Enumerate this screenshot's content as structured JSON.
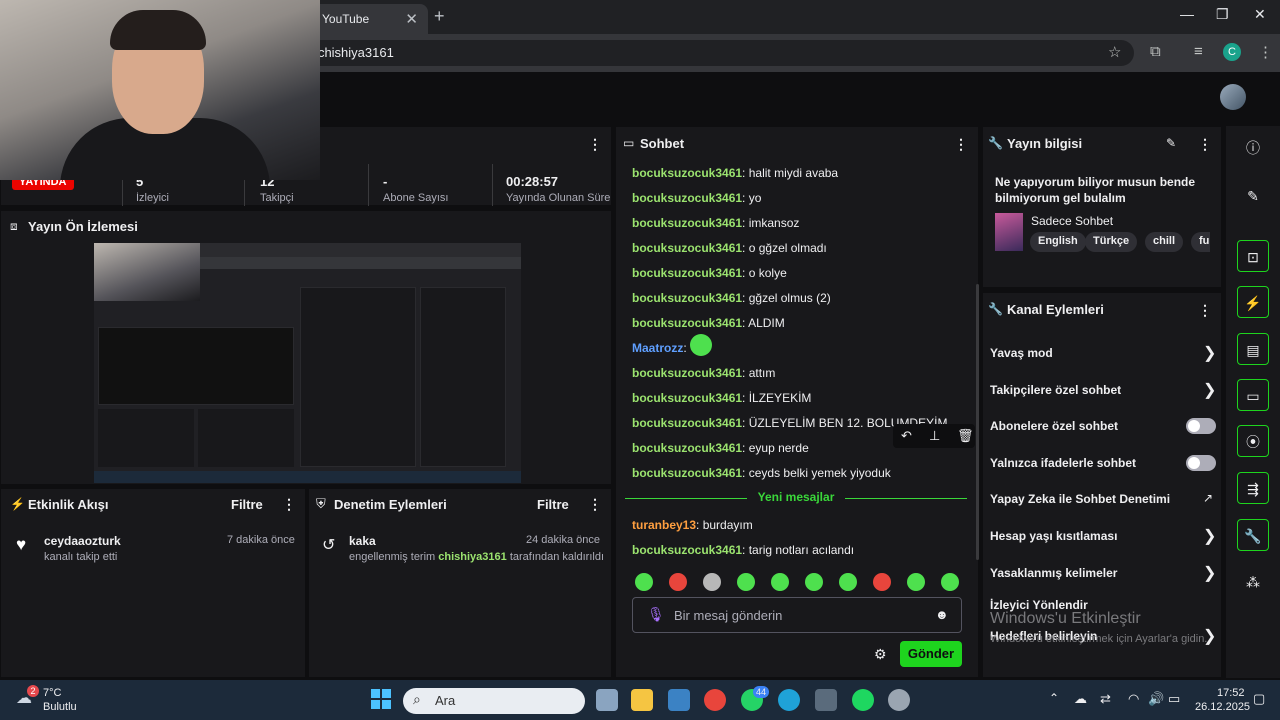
{
  "browser": {
    "tab_title": "YouTube",
    "url": "r/chishiya3161"
  },
  "stats": {
    "live_label": "YAYINDA",
    "values": [
      "5",
      "12",
      "-",
      "00:28:57"
    ],
    "labels": [
      "İzleyici",
      "Takipçi",
      "Abone Sayısı",
      "Yayında Olunan Süre"
    ]
  },
  "preview": {
    "title": "Yayın Ön İzlemesi"
  },
  "activity": {
    "title": "Etkinlik Akışı",
    "filter": "Filtre",
    "item_user": "ceydaaozturk",
    "item_text": "kanalı takip etti",
    "item_time": "7 dakika önce"
  },
  "moderation": {
    "title": "Denetim Eylemleri",
    "filter": "Filtre",
    "item_user": "kaka",
    "item_text_a": "engellenmiş terim",
    "item_mod": "chishiya3161",
    "item_text_b": "tarafından kaldırıldı",
    "item_time": "24 dakika önce"
  },
  "chat": {
    "title": "Sohbet",
    "messages": [
      {
        "user": "bocuksuzocuk3461",
        "text": "halit miydi avaba",
        "color": "green"
      },
      {
        "user": "bocuksuzocuk3461",
        "text": "yo",
        "color": "green"
      },
      {
        "user": "bocuksuzocuk3461",
        "text": "imkansoz",
        "color": "green"
      },
      {
        "user": "bocuksuzocuk3461",
        "text": "o gğzel olmadı",
        "color": "green"
      },
      {
        "user": "bocuksuzocuk3461",
        "text": "o kolye",
        "color": "green"
      },
      {
        "user": "bocuksuzocuk3461",
        "text": "gğzel olmus (2)",
        "color": "green"
      },
      {
        "user": "bocuksuzocuk3461",
        "text": "ALDIM",
        "color": "green"
      },
      {
        "user": "Maatrozz",
        "text": "",
        "color": "blue"
      },
      {
        "user": "bocuksuzocuk3461",
        "text": "attım",
        "color": "green"
      },
      {
        "user": "bocuksuzocuk3461",
        "text": "İLZEYEKİM",
        "color": "green"
      },
      {
        "user": "bocuksuzocuk3461",
        "text": "ÜZLEYELİM BEN 12. BOLUMDEYİM",
        "color": "green"
      },
      {
        "user": "bocuksuzocuk3461",
        "text": "eyup nerde",
        "color": "green"
      },
      {
        "user": "bocuksuzocuk3461",
        "text": "ceyds belki yemek yiyoduk",
        "color": "green"
      }
    ],
    "new_messages_label": "Yeni mesajlar",
    "new_messages": [
      {
        "user": "turanbey13",
        "text": "burdayım",
        "color": "orange"
      },
      {
        "user": "bocuksuzocuk3461",
        "text": "tarig notları acılandı",
        "color": "green"
      }
    ],
    "input_placeholder": "Bir mesaj gönderin",
    "send_label": "Gönder"
  },
  "stream_info": {
    "title": "Yayın bilgisi",
    "stream_title": "Ne yapıyorum biliyor musun bende bilmiyorum gel bulalım",
    "category": "Sadece Sohbet",
    "tags": [
      "English",
      "Türkçe",
      "chill",
      "funny"
    ]
  },
  "channel_actions": {
    "title": "Kanal Eylemleri",
    "items": [
      {
        "label": "Yavaş mod",
        "control": "chevron"
      },
      {
        "label": "Takipçilere özel sohbet",
        "control": "chevron"
      },
      {
        "label": "Abonelere özel sohbet",
        "control": "toggle"
      },
      {
        "label": "Yalnızca ifadelerle sohbet",
        "control": "toggle"
      },
      {
        "label": "Yapay Zeka ile Sohbet Denetimi",
        "control": "external"
      },
      {
        "label": "Hesap yaşı kısıtlaması",
        "control": "chevron"
      },
      {
        "label": "Yasaklanmış kelimeler",
        "control": "chevron"
      },
      {
        "label": "İzleyici Yönlendir",
        "control": "none"
      },
      {
        "label": "Hedefleri belirleyin",
        "control": "chevron"
      }
    ]
  },
  "watermark": {
    "line1": "Windows'u Etkinleştir",
    "line2": "Windows'u etkinleştirmek için Ayarlar'a gidin."
  },
  "taskbar": {
    "weather_temp": "7°C",
    "weather_desc": "Bulutlu",
    "weather_badge": "2",
    "search_label": "Ara",
    "whatsapp_badge": "44",
    "time": "17:52",
    "date": "26.12.2025"
  },
  "colors": {
    "accent_green": "#1ed41e",
    "live_red": "#eb0400",
    "chat_green_user": "#9be36f"
  }
}
